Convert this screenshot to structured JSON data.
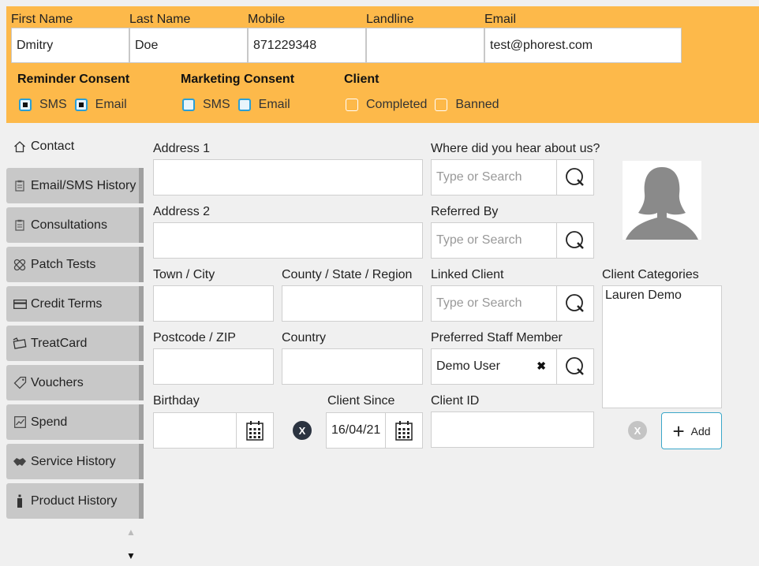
{
  "header": {
    "first_name": {
      "label": "First Name",
      "value": "Dmitry"
    },
    "last_name": {
      "label": "Last Name",
      "value": "Doe"
    },
    "mobile": {
      "label": "Mobile",
      "value": "871229348"
    },
    "landline": {
      "label": "Landline",
      "value": ""
    },
    "email": {
      "label": "Email",
      "value": "test@phorest.com"
    },
    "reminder_consent": {
      "title": "Reminder Consent",
      "sms": "SMS",
      "email": "Email",
      "sms_checked": true,
      "email_checked": true
    },
    "marketing_consent": {
      "title": "Marketing Consent",
      "sms": "SMS",
      "email": "Email",
      "sms_checked": false,
      "email_checked": false
    },
    "client": {
      "title": "Client",
      "completed": "Completed",
      "banned": "Banned"
    }
  },
  "sidebar": {
    "items": [
      {
        "label": "Contact",
        "icon": "home-icon"
      },
      {
        "label": "Email/SMS History",
        "icon": "clipboard-icon"
      },
      {
        "label": "Consultations",
        "icon": "clipboard-icon"
      },
      {
        "label": "Patch Tests",
        "icon": "bandage-icon"
      },
      {
        "label": "Credit Terms",
        "icon": "card-icon"
      },
      {
        "label": "TreatCard",
        "icon": "treatcard-icon"
      },
      {
        "label": "Vouchers",
        "icon": "tag-icon"
      },
      {
        "label": "Spend",
        "icon": "chart-icon"
      },
      {
        "label": "Service History",
        "icon": "handshake-icon"
      },
      {
        "label": "Product History",
        "icon": "bottle-icon"
      }
    ]
  },
  "form": {
    "address1": {
      "label": "Address 1",
      "value": ""
    },
    "address2": {
      "label": "Address 2",
      "value": ""
    },
    "town": {
      "label": "Town / City",
      "value": ""
    },
    "county": {
      "label": "County / State / Region",
      "value": ""
    },
    "postcode": {
      "label": "Postcode / ZIP",
      "value": ""
    },
    "country": {
      "label": "Country",
      "value": ""
    },
    "birthday": {
      "label": "Birthday",
      "value": ""
    },
    "client_since": {
      "label": "Client Since",
      "value": "16/04/21"
    },
    "hear_about": {
      "label": "Where did you hear about us?",
      "placeholder": "Type or Search"
    },
    "referred_by": {
      "label": "Referred By",
      "placeholder": "Type or Search"
    },
    "linked_client": {
      "label": "Linked Client",
      "placeholder": "Type or Search"
    },
    "preferred_staff": {
      "label": "Preferred Staff Member",
      "value": "Demo User",
      "clear": "✖"
    },
    "client_id": {
      "label": "Client ID",
      "value": ""
    },
    "client_categories": {
      "label": "Client Categories",
      "items": [
        "Lauren Demo"
      ]
    },
    "clear_glyph": "X",
    "add_label": "Add",
    "add_glyph": "+"
  },
  "colors": {
    "header_bg": "#fdb94a",
    "checkbox_blue": "#2a9fd6",
    "add_border": "#3ba7c9"
  }
}
